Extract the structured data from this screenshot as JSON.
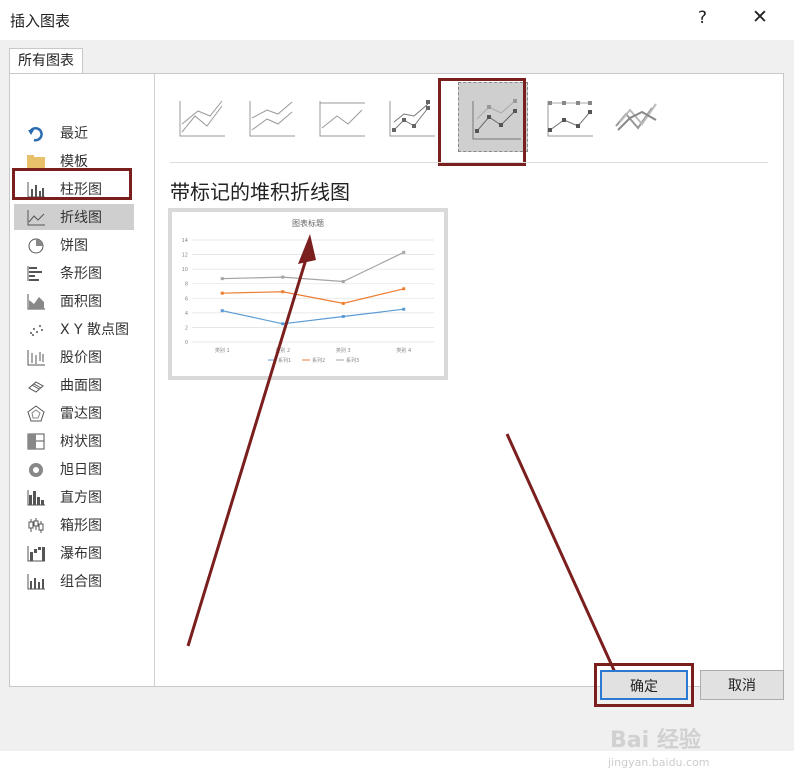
{
  "window": {
    "title": "插入图表",
    "help": "?",
    "close": "✕"
  },
  "tab": {
    "label": "所有图表"
  },
  "sidebar": {
    "items": [
      {
        "label": "最近",
        "icon": "recent-icon"
      },
      {
        "label": "模板",
        "icon": "folder-icon"
      },
      {
        "label": "柱形图",
        "icon": "column-chart-icon"
      },
      {
        "label": "折线图",
        "icon": "line-chart-icon",
        "selected": true
      },
      {
        "label": "饼图",
        "icon": "pie-chart-icon"
      },
      {
        "label": "条形图",
        "icon": "bar-chart-icon"
      },
      {
        "label": "面积图",
        "icon": "area-chart-icon"
      },
      {
        "label": "X Y 散点图",
        "icon": "scatter-chart-icon"
      },
      {
        "label": "股价图",
        "icon": "stock-chart-icon"
      },
      {
        "label": "曲面图",
        "icon": "surface-chart-icon"
      },
      {
        "label": "雷达图",
        "icon": "radar-chart-icon"
      },
      {
        "label": "树状图",
        "icon": "treemap-chart-icon"
      },
      {
        "label": "旭日图",
        "icon": "sunburst-chart-icon"
      },
      {
        "label": "直方图",
        "icon": "histogram-chart-icon"
      },
      {
        "label": "箱形图",
        "icon": "box-whisker-chart-icon"
      },
      {
        "label": "瀑布图",
        "icon": "waterfall-chart-icon"
      },
      {
        "label": "组合图",
        "icon": "combo-chart-icon"
      }
    ]
  },
  "subtypes": [
    "line",
    "stacked-line",
    "100-stacked-line",
    "line-markers",
    "stacked-line-markers",
    "100-stacked-line-markers",
    "3d-line"
  ],
  "selected_subtype_index": 4,
  "chart_type_title": "带标记的堆积折线图",
  "chart_data": {
    "type": "line",
    "title": "图表标题",
    "categories": [
      "类别 1",
      "类别 2",
      "类别 3",
      "类别 4"
    ],
    "ylim": [
      0,
      14
    ],
    "yticks": [
      "0",
      "2",
      "4",
      "6",
      "8",
      "10",
      "12",
      "14"
    ],
    "series": [
      {
        "name": "系列1",
        "values": [
          4.3,
          2.5,
          3.5,
          4.5
        ],
        "color": "#5b9bd5"
      },
      {
        "name": "系列2",
        "values": [
          6.7,
          6.9,
          5.3,
          7.3
        ],
        "color": "#ed7d31"
      },
      {
        "name": "系列3",
        "values": [
          8.7,
          8.9,
          8.3,
          12.3
        ],
        "color": "#a5a5a5"
      }
    ],
    "legend": "bottom",
    "grid": true
  },
  "buttons": {
    "ok": "确定",
    "cancel": "取消"
  },
  "watermark": {
    "line1": "Bai 经验",
    "line2": "jingyan.baidu.com"
  },
  "colors": {
    "annotation": "#7a1e1e",
    "selected_bg": "#cfcfcf",
    "ok_border": "#2a7ad2"
  }
}
